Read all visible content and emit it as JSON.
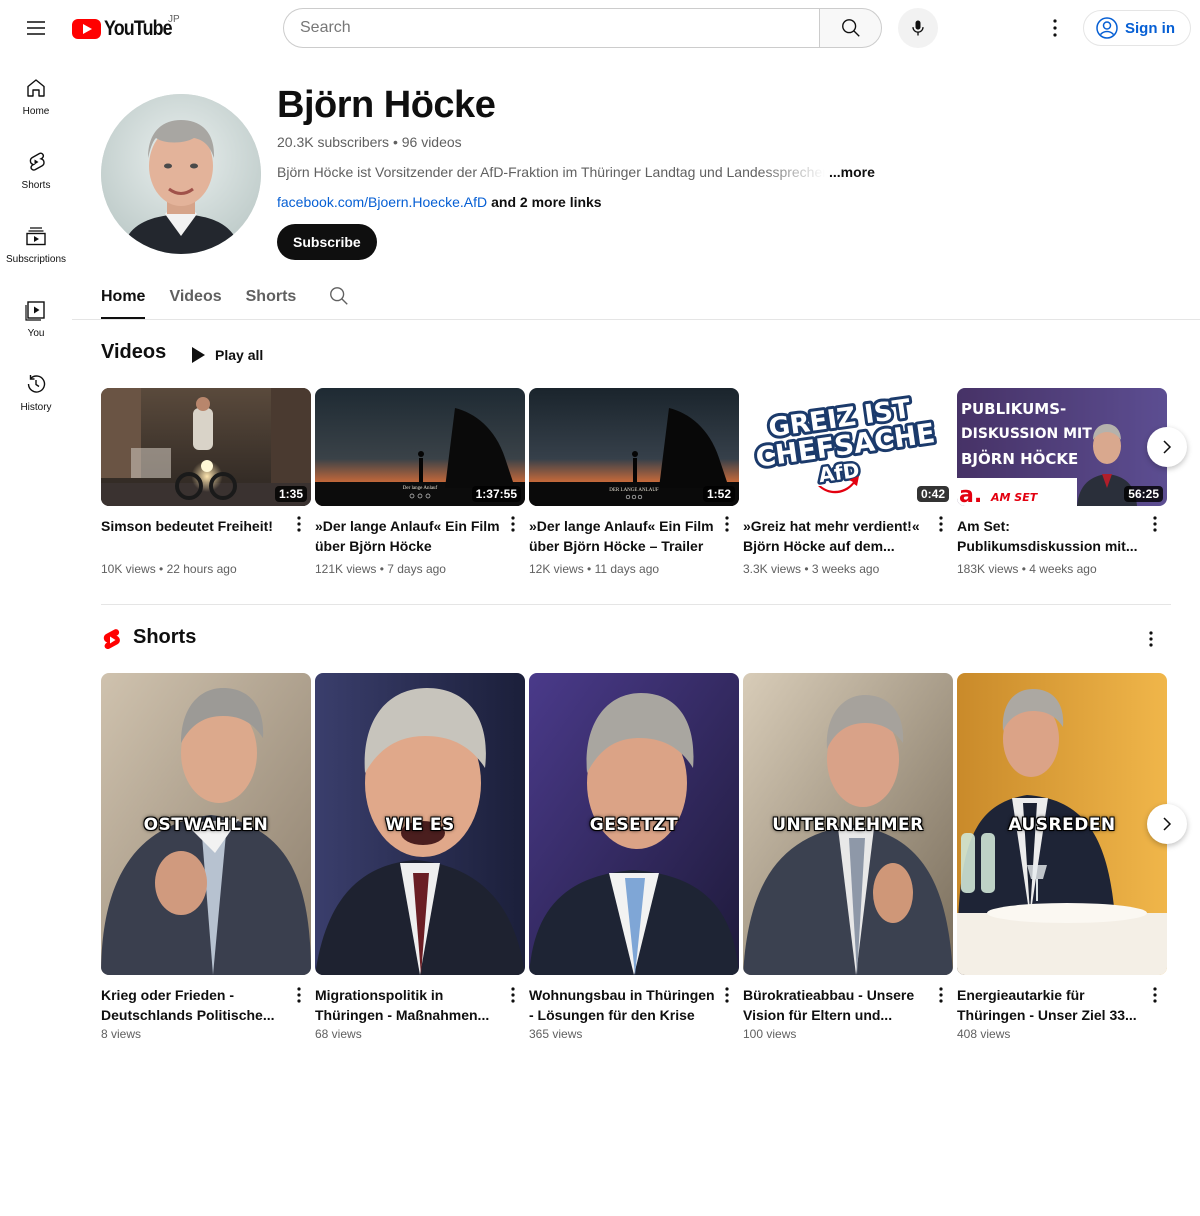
{
  "masthead": {
    "logo_text": "YouTube",
    "country_code": "JP",
    "search_placeholder": "Search",
    "signin_label": "Sign in"
  },
  "sidebar": {
    "items": [
      {
        "label": "Home",
        "icon": "home-icon"
      },
      {
        "label": "Shorts",
        "icon": "shorts-icon"
      },
      {
        "label": "Subscriptions",
        "icon": "subscriptions-icon"
      },
      {
        "label": "You",
        "icon": "you-icon"
      },
      {
        "label": "History",
        "icon": "history-icon"
      }
    ]
  },
  "channel": {
    "name": "Björn Höcke",
    "stats": "20.3K subscribers • 96 videos",
    "description": "Björn Höcke ist Vorsitzender der AfD-Fraktion im Thüringer Landtag und Landessprecher",
    "more_label": "...more",
    "link": "facebook.com/Bjoern.Hoecke.AfD",
    "more_links": "and 2 more links",
    "subscribe_label": "Subscribe"
  },
  "tabs": [
    "Home",
    "Videos",
    "Shorts"
  ],
  "videos_section": {
    "title": "Videos",
    "play_all": "Play all",
    "items": [
      {
        "title": "Simson bedeutet Freiheit!",
        "duration": "1:35",
        "views": "10K views",
        "age": "22 hours ago"
      },
      {
        "title": "»Der lange Anlauf« Ein Film über Björn Höcke",
        "duration": "1:37:55",
        "views": "121K views",
        "age": "7 days ago",
        "overlay": "Der lange Anlauf"
      },
      {
        "title": "»Der lange Anlauf« Ein Film über Björn Höcke – Trailer",
        "duration": "1:52",
        "views": "12K views",
        "age": "11 days ago",
        "overlay": "DER LANGE ANLAUF"
      },
      {
        "title": "»Greiz hat mehr verdient!« Björn Höcke auf dem...",
        "duration": "0:42",
        "views": "3.3K views",
        "age": "3 weeks ago",
        "thumb_lines": [
          "GREIZ IST",
          "CHEFSACHE",
          "AfD"
        ]
      },
      {
        "title": "Am Set: Publikumsdiskussion mit...",
        "duration": "56:25",
        "views": "183K views",
        "age": "4 weeks ago",
        "thumb_lines": [
          "PUBLIKUMS-",
          "DISKUSSION MIT",
          "BJÖRN HÖCKE"
        ],
        "badge": "AM SET"
      }
    ]
  },
  "shorts_section": {
    "title": "Shorts",
    "items": [
      {
        "caption": "OSTWAHLEN",
        "title": "Krieg oder Frieden - Deutschlands Politische...",
        "views": "8 views"
      },
      {
        "caption": "WIE ES",
        "title": "Migrationspolitik in Thüringen - Maßnahmen...",
        "views": "68 views"
      },
      {
        "caption": "GESETZT",
        "title": "Wohnungsbau in Thüringen - Lösungen für den Krise",
        "views": "365 views"
      },
      {
        "caption": "UNTERNEHMER",
        "title": "Bürokratieabbau - Unsere Vision für Eltern und...",
        "views": "100 views"
      },
      {
        "caption": "AUSREDEN",
        "title": "Energieautarkie für Thüringen - Unser Ziel 33...",
        "views": "408 views"
      }
    ]
  },
  "colors": {
    "brand_red": "#ff0000",
    "link_blue": "#065fd4",
    "text_secondary": "#606060"
  }
}
